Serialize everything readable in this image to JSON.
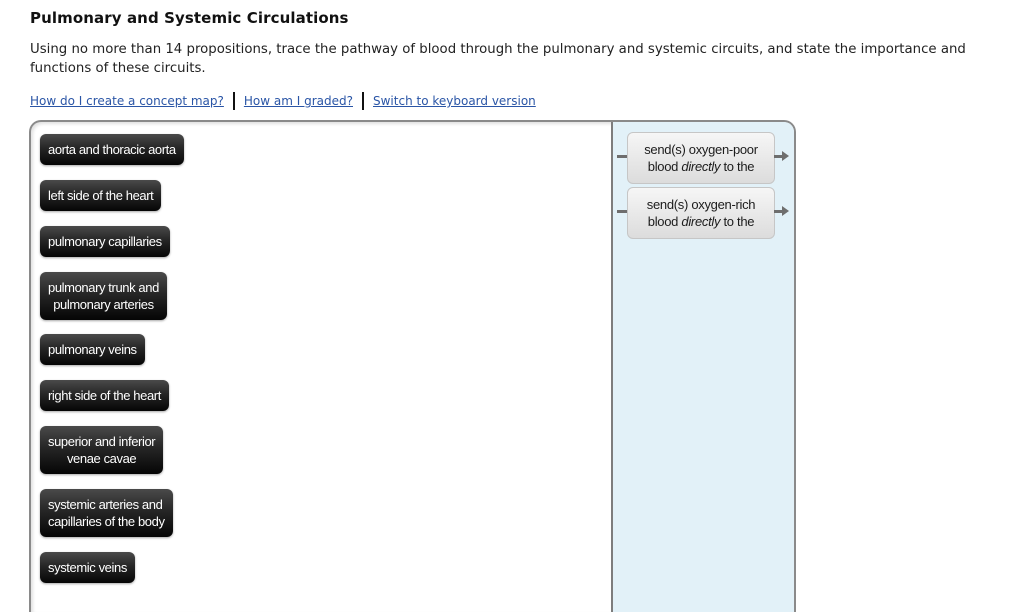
{
  "page": {
    "title": "Pulmonary and Systemic Circulations",
    "instructions": "Using no more than 14 propositions, trace the pathway of blood through the pulmonary and systemic circuits, and state the importance and functions of these circuits."
  },
  "links": [
    {
      "label": "How do I create a concept map?"
    },
    {
      "label": "How am I graded?"
    },
    {
      "label": "Switch to keyboard version"
    }
  ],
  "terms": [
    {
      "label": "aorta and thoracic aorta"
    },
    {
      "label": "left side of the heart"
    },
    {
      "label": "pulmonary capillaries"
    },
    {
      "label": "pulmonary trunk and\npulmonary arteries"
    },
    {
      "label": "pulmonary veins"
    },
    {
      "label": "right side of the heart"
    },
    {
      "label": "superior and inferior\nvenae cavae"
    },
    {
      "label": "systemic arteries and\ncapillaries of the body"
    },
    {
      "label": "systemic veins"
    }
  ],
  "linking_phrases": [
    {
      "line1": "send(s) oxygen-poor",
      "pre": "blood ",
      "emph": "directly",
      "post": " to the"
    },
    {
      "line1": "send(s) oxygen-rich",
      "pre": "blood ",
      "emph": "directly",
      "post": " to the"
    }
  ],
  "colors": {
    "link": "#2a55a6",
    "term_bg": "#1a1a1a",
    "panel_bg": "#e2f1f8",
    "linker_bg": "#e8e8e8"
  }
}
